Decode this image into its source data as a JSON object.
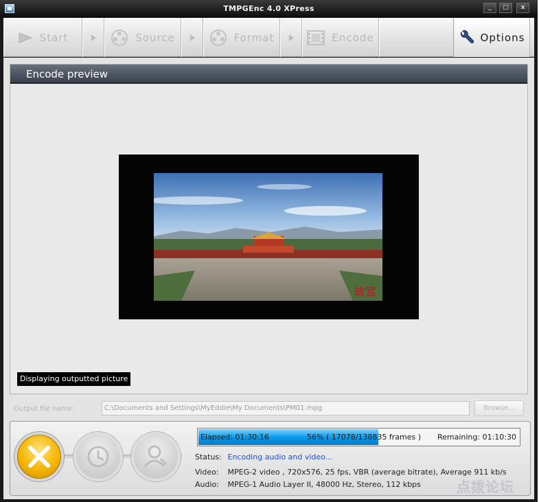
{
  "window": {
    "title": "TMPGEnc 4.0 XPress",
    "controls": [
      "_",
      "□",
      "x"
    ]
  },
  "toolbar": {
    "start_label": "Start",
    "source_label": "Source",
    "format_label": "Format",
    "encode_label": "Encode",
    "options_label": "Options"
  },
  "preview": {
    "title": "Encode preview",
    "overlay_text": "Displaying outputted picture"
  },
  "output": {
    "label": "Output file name:",
    "value": "C:\\Documents and Settings\\MyEddie\\My Documents\\PM01.mpg",
    "browse_label": "Browse..."
  },
  "progress": {
    "elapsed": "Elapsed: 01:30:16",
    "percent_text": "56% ( 17078/138835  frames )",
    "percent_value": 0.56,
    "remaining": "Remaining: 01:10:30"
  },
  "info": {
    "status_key": "Status:",
    "status_value": "Encoding audio and video...",
    "video_key": "Video:",
    "video_value": "MPEG-2 video , 720x576, 25 fps, VBR (average bitrate), Average 911 kb/s",
    "audio_key": "Audio:",
    "audio_value": "MPEG-1 Audio Layer II, 48000 Hz, Stereo, 112 kbps"
  },
  "watermark": "点拨论坛",
  "colors": {
    "progress_fill": "#0c9cea",
    "cancel_button": "#f4b400",
    "status_text": "#1b4fd6",
    "preview_header": "#4a525e"
  }
}
